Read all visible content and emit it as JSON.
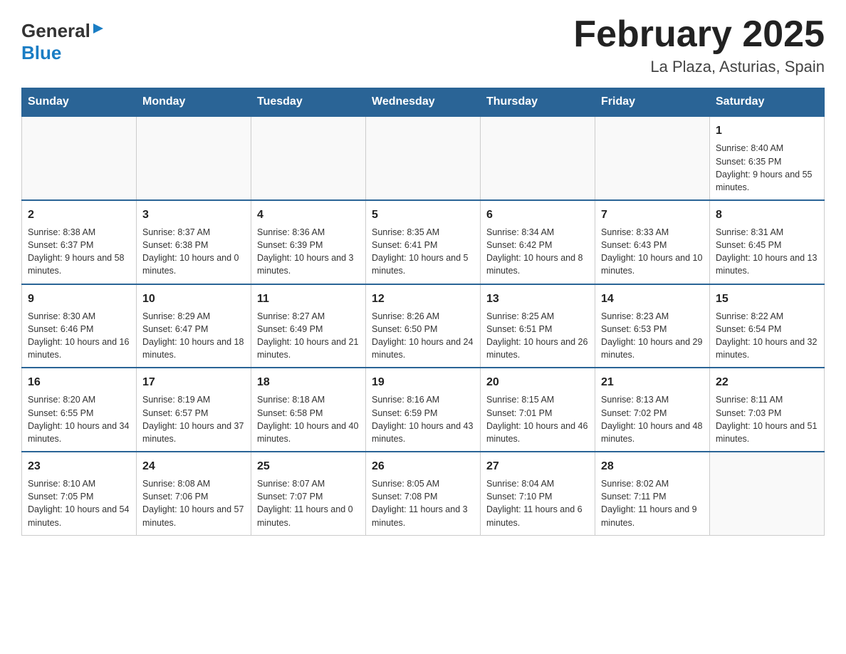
{
  "header": {
    "logo_general": "General",
    "logo_blue": "Blue",
    "title": "February 2025",
    "subtitle": "La Plaza, Asturias, Spain"
  },
  "weekdays": [
    "Sunday",
    "Monday",
    "Tuesday",
    "Wednesday",
    "Thursday",
    "Friday",
    "Saturday"
  ],
  "weeks": [
    [
      {
        "day": "",
        "info": ""
      },
      {
        "day": "",
        "info": ""
      },
      {
        "day": "",
        "info": ""
      },
      {
        "day": "",
        "info": ""
      },
      {
        "day": "",
        "info": ""
      },
      {
        "day": "",
        "info": ""
      },
      {
        "day": "1",
        "info": "Sunrise: 8:40 AM\nSunset: 6:35 PM\nDaylight: 9 hours and 55 minutes."
      }
    ],
    [
      {
        "day": "2",
        "info": "Sunrise: 8:38 AM\nSunset: 6:37 PM\nDaylight: 9 hours and 58 minutes."
      },
      {
        "day": "3",
        "info": "Sunrise: 8:37 AM\nSunset: 6:38 PM\nDaylight: 10 hours and 0 minutes."
      },
      {
        "day": "4",
        "info": "Sunrise: 8:36 AM\nSunset: 6:39 PM\nDaylight: 10 hours and 3 minutes."
      },
      {
        "day": "5",
        "info": "Sunrise: 8:35 AM\nSunset: 6:41 PM\nDaylight: 10 hours and 5 minutes."
      },
      {
        "day": "6",
        "info": "Sunrise: 8:34 AM\nSunset: 6:42 PM\nDaylight: 10 hours and 8 minutes."
      },
      {
        "day": "7",
        "info": "Sunrise: 8:33 AM\nSunset: 6:43 PM\nDaylight: 10 hours and 10 minutes."
      },
      {
        "day": "8",
        "info": "Sunrise: 8:31 AM\nSunset: 6:45 PM\nDaylight: 10 hours and 13 minutes."
      }
    ],
    [
      {
        "day": "9",
        "info": "Sunrise: 8:30 AM\nSunset: 6:46 PM\nDaylight: 10 hours and 16 minutes."
      },
      {
        "day": "10",
        "info": "Sunrise: 8:29 AM\nSunset: 6:47 PM\nDaylight: 10 hours and 18 minutes."
      },
      {
        "day": "11",
        "info": "Sunrise: 8:27 AM\nSunset: 6:49 PM\nDaylight: 10 hours and 21 minutes."
      },
      {
        "day": "12",
        "info": "Sunrise: 8:26 AM\nSunset: 6:50 PM\nDaylight: 10 hours and 24 minutes."
      },
      {
        "day": "13",
        "info": "Sunrise: 8:25 AM\nSunset: 6:51 PM\nDaylight: 10 hours and 26 minutes."
      },
      {
        "day": "14",
        "info": "Sunrise: 8:23 AM\nSunset: 6:53 PM\nDaylight: 10 hours and 29 minutes."
      },
      {
        "day": "15",
        "info": "Sunrise: 8:22 AM\nSunset: 6:54 PM\nDaylight: 10 hours and 32 minutes."
      }
    ],
    [
      {
        "day": "16",
        "info": "Sunrise: 8:20 AM\nSunset: 6:55 PM\nDaylight: 10 hours and 34 minutes."
      },
      {
        "day": "17",
        "info": "Sunrise: 8:19 AM\nSunset: 6:57 PM\nDaylight: 10 hours and 37 minutes."
      },
      {
        "day": "18",
        "info": "Sunrise: 8:18 AM\nSunset: 6:58 PM\nDaylight: 10 hours and 40 minutes."
      },
      {
        "day": "19",
        "info": "Sunrise: 8:16 AM\nSunset: 6:59 PM\nDaylight: 10 hours and 43 minutes."
      },
      {
        "day": "20",
        "info": "Sunrise: 8:15 AM\nSunset: 7:01 PM\nDaylight: 10 hours and 46 minutes."
      },
      {
        "day": "21",
        "info": "Sunrise: 8:13 AM\nSunset: 7:02 PM\nDaylight: 10 hours and 48 minutes."
      },
      {
        "day": "22",
        "info": "Sunrise: 8:11 AM\nSunset: 7:03 PM\nDaylight: 10 hours and 51 minutes."
      }
    ],
    [
      {
        "day": "23",
        "info": "Sunrise: 8:10 AM\nSunset: 7:05 PM\nDaylight: 10 hours and 54 minutes."
      },
      {
        "day": "24",
        "info": "Sunrise: 8:08 AM\nSunset: 7:06 PM\nDaylight: 10 hours and 57 minutes."
      },
      {
        "day": "25",
        "info": "Sunrise: 8:07 AM\nSunset: 7:07 PM\nDaylight: 11 hours and 0 minutes."
      },
      {
        "day": "26",
        "info": "Sunrise: 8:05 AM\nSunset: 7:08 PM\nDaylight: 11 hours and 3 minutes."
      },
      {
        "day": "27",
        "info": "Sunrise: 8:04 AM\nSunset: 7:10 PM\nDaylight: 11 hours and 6 minutes."
      },
      {
        "day": "28",
        "info": "Sunrise: 8:02 AM\nSunset: 7:11 PM\nDaylight: 11 hours and 9 minutes."
      },
      {
        "day": "",
        "info": ""
      }
    ]
  ]
}
